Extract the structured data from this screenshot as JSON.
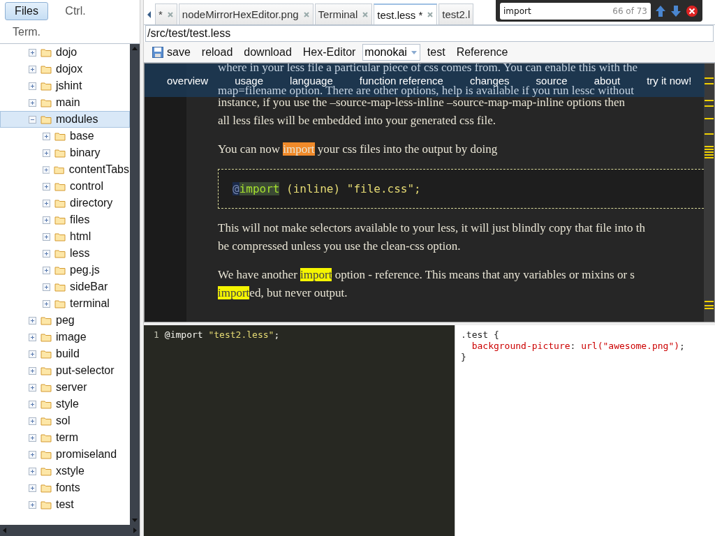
{
  "sidebar": {
    "tabs": [
      {
        "label": "Files",
        "selected": true
      },
      {
        "label": "Ctrl.",
        "selected": false
      },
      {
        "label": "Term.",
        "selected": false
      }
    ],
    "tree": [
      {
        "label": "dojo",
        "expanded": false,
        "selected": false
      },
      {
        "label": "dojox",
        "expanded": false,
        "selected": false
      },
      {
        "label": "jshint",
        "expanded": false,
        "selected": false
      },
      {
        "label": "main",
        "expanded": false,
        "selected": false
      },
      {
        "label": "modules",
        "expanded": true,
        "selected": true,
        "children": [
          {
            "label": "base",
            "expanded": false,
            "selected": false
          },
          {
            "label": "binary",
            "expanded": false,
            "selected": false
          },
          {
            "label": "contentTabs",
            "expanded": false,
            "selected": false
          },
          {
            "label": "control",
            "expanded": false,
            "selected": false
          },
          {
            "label": "directory",
            "expanded": false,
            "selected": false
          },
          {
            "label": "files",
            "expanded": false,
            "selected": false
          },
          {
            "label": "html",
            "expanded": false,
            "selected": false
          },
          {
            "label": "less",
            "expanded": false,
            "selected": false
          },
          {
            "label": "peg.js",
            "expanded": false,
            "selected": false
          },
          {
            "label": "sideBar",
            "expanded": false,
            "selected": false
          },
          {
            "label": "terminal",
            "expanded": false,
            "selected": false
          }
        ]
      },
      {
        "label": "peg",
        "expanded": false,
        "selected": false
      },
      {
        "label": "image",
        "expanded": false,
        "selected": false
      },
      {
        "label": "build",
        "expanded": false,
        "selected": false
      },
      {
        "label": "put-selector",
        "expanded": false,
        "selected": false
      },
      {
        "label": "server",
        "expanded": false,
        "selected": false
      },
      {
        "label": "style",
        "expanded": false,
        "selected": false
      },
      {
        "label": "sol",
        "expanded": false,
        "selected": false
      },
      {
        "label": "term",
        "expanded": false,
        "selected": false
      },
      {
        "label": "promiseland",
        "expanded": false,
        "selected": false
      },
      {
        "label": "xstyle",
        "expanded": false,
        "selected": false
      },
      {
        "label": "fonts",
        "expanded": false,
        "selected": false
      },
      {
        "label": "test",
        "expanded": false,
        "selected": false
      }
    ]
  },
  "editor_tabs": [
    {
      "label": "*",
      "selected": false,
      "closable": true
    },
    {
      "label": "nodeMirrorHexEditor.png",
      "selected": false,
      "closable": true
    },
    {
      "label": "Terminal",
      "selected": false,
      "closable": true
    },
    {
      "label": "test.less *",
      "selected": true,
      "closable": true
    },
    {
      "label": "test2.l",
      "selected": false,
      "closable": false
    }
  ],
  "search": {
    "value": "import",
    "count": "66 of 73"
  },
  "path": "/src/test/test.less",
  "toolbar": [
    {
      "kind": "icon-button",
      "label": "save"
    },
    {
      "kind": "button",
      "label": "reload"
    },
    {
      "kind": "button",
      "label": "download"
    },
    {
      "kind": "button",
      "label": "Hex-Editor"
    },
    {
      "kind": "select",
      "label": "monokai"
    },
    {
      "kind": "button",
      "label": "test"
    },
    {
      "kind": "button",
      "label": "Reference"
    }
  ],
  "preview": {
    "nav": [
      "overview",
      "usage",
      "language",
      "function reference",
      "changes",
      "source",
      "about",
      "try it now!"
    ],
    "blocks": [
      {
        "kind": "covered",
        "lines": [
          [
            {
              "text": "where in your less file a particular piece of css comes from. You can enable this with the",
              "kind": "plain"
            }
          ],
          [
            {
              "text": "map=filename option. There are other options, help is available if you run lessc without",
              "kind": "plain"
            }
          ]
        ]
      },
      {
        "kind": "paragraph",
        "lines": [
          [
            {
              "text": "instance, if you use the –source-map-less-inline –source-map-map-inline options then",
              "kind": "plain"
            }
          ],
          [
            {
              "text": "all less files will be embedded into your generated css file.",
              "kind": "plain"
            }
          ]
        ]
      },
      {
        "kind": "paragraph",
        "lines": [
          [
            {
              "text": "You can now ",
              "kind": "plain"
            },
            {
              "text": "import",
              "kind": "current"
            },
            {
              "text": " your css files into the output by doing",
              "kind": "plain"
            }
          ]
        ]
      },
      {
        "kind": "code",
        "lines": [
          [
            {
              "text": "@",
              "kind": "cursor"
            },
            {
              "text": "import",
              "kind": "selection"
            },
            {
              "text": " (inline) \"file.css\";",
              "kind": "plain"
            }
          ]
        ]
      },
      {
        "kind": "paragraph",
        "lines": [
          [
            {
              "text": "This will not make selectors available to your less, it will just blindly copy that file into th",
              "kind": "plain"
            }
          ],
          [
            {
              "text": "be compressed unless you use the clean-css option.",
              "kind": "plain"
            }
          ]
        ]
      },
      {
        "kind": "paragraph",
        "lines": [
          [
            {
              "text": "We have another ",
              "kind": "plain"
            },
            {
              "text": "import",
              "kind": "match"
            },
            {
              "text": " option - reference. This means that any variables or mixins or s",
              "kind": "plain"
            }
          ],
          [
            {
              "text": "import",
              "kind": "match"
            },
            {
              "text": "ed, but never output.",
              "kind": "plain"
            }
          ]
        ]
      }
    ]
  },
  "source": {
    "lines": [
      {
        "number": "1",
        "tokens": [
          {
            "text": "@import ",
            "kind": "plain"
          },
          {
            "text": "\"test2.less\"",
            "kind": "string"
          },
          {
            "text": ";",
            "kind": "plain"
          }
        ]
      }
    ]
  },
  "output": {
    "lines": [
      [
        {
          "text": ".test {",
          "kind": "plain"
        }
      ],
      [
        {
          "text": "  background-picture",
          "kind": "property"
        },
        {
          "text": ": ",
          "kind": "plain"
        },
        {
          "text": "url(\"awesome.png\")",
          "kind": "value"
        },
        {
          "text": ";",
          "kind": "plain"
        }
      ],
      [
        {
          "text": "}",
          "kind": "plain"
        }
      ]
    ]
  }
}
